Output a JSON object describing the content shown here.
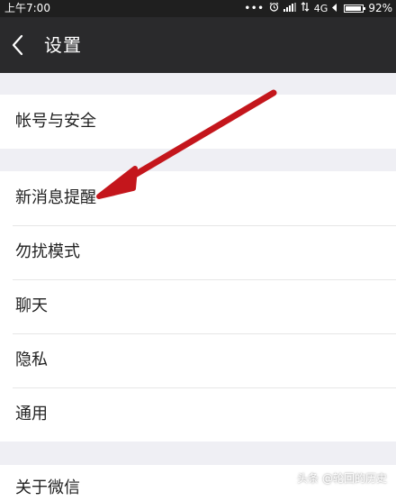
{
  "status_bar": {
    "time": "上午7:00",
    "dots": "•••",
    "network": "4G",
    "battery_percent": "92%",
    "battery_level": 0.92
  },
  "header": {
    "title": "设置"
  },
  "menu": {
    "group1": [
      "帐号与安全"
    ],
    "group2": [
      "新消息提醒",
      "勿扰模式",
      "聊天",
      "隐私",
      "通用"
    ],
    "group3": [
      "关于微信"
    ]
  },
  "watermark": "头条 @轮回的历史",
  "colors": {
    "header_bg": "#2a2a2c",
    "status_bg": "#1f1f1f",
    "page_bg": "#efeff4",
    "arrow": "#c4161c"
  }
}
